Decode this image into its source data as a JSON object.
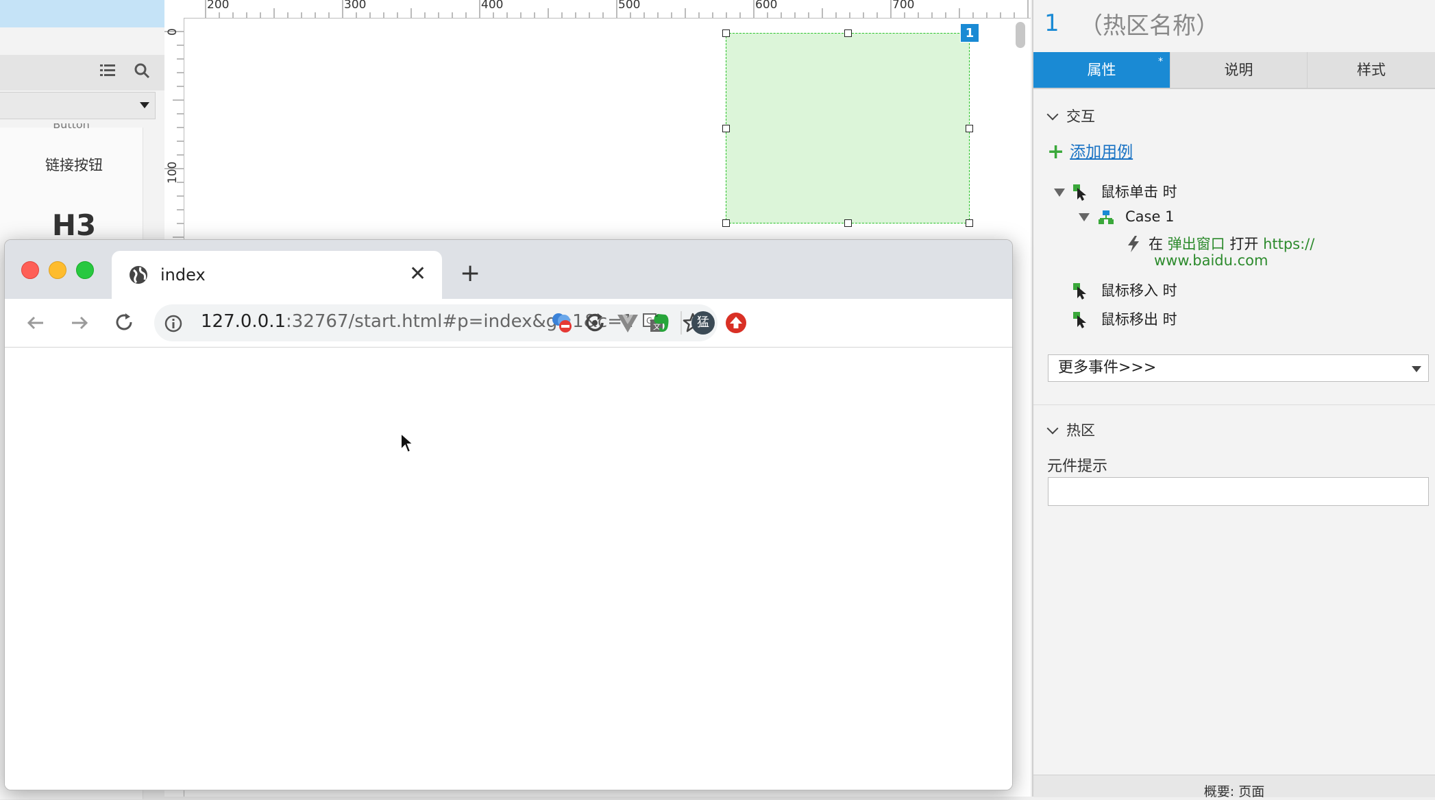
{
  "left_panel": {
    "menu_icon": "menu-lines-icon",
    "search_icon": "search-icon",
    "dropdown_value": "",
    "cut_label": "Button",
    "link_button_label": "链接按钮",
    "h3_label": "H3"
  },
  "canvas": {
    "ruler_top_labels": [
      "200",
      "300",
      "400",
      "500",
      "600",
      "700"
    ],
    "ruler_left_labels": [
      "0",
      "100"
    ],
    "hotspot_badge": "1",
    "hotspot_fill": "#dcf5d9",
    "hotspot_border": "#27c227"
  },
  "inspector": {
    "widget_number": "1",
    "widget_name": "（热区名称）",
    "tabs": [
      {
        "label": "属性",
        "active": true,
        "marker": "*"
      },
      {
        "label": "说明",
        "active": false
      },
      {
        "label": "样式",
        "active": false
      }
    ],
    "interaction_section": "交互",
    "add_case_label": "添加用例",
    "events": {
      "click": "鼠标单击 时",
      "case_name": "Case 1",
      "action_prefix": "在",
      "action_target": "弹出窗口",
      "action_verb": "打开",
      "action_url_line1": "https://",
      "action_url_line2": "www.baidu.com",
      "mouse_enter": "鼠标移入 时",
      "mouse_leave": "鼠标移出 时"
    },
    "more_events_label": "更多事件>>>",
    "hotspot_section": "热区",
    "tooltip_label": "元件提示",
    "tooltip_value": "",
    "bottom_label": "概要: 页面",
    "accent_color": "#1a8ad4"
  },
  "browser": {
    "tab_title": "index",
    "tab_icon": "globe-icon",
    "url_host": "127.0.0.1",
    "url_path": ":32767/start.html#p=index&g=1&c=1",
    "profile_initial": "猛"
  }
}
